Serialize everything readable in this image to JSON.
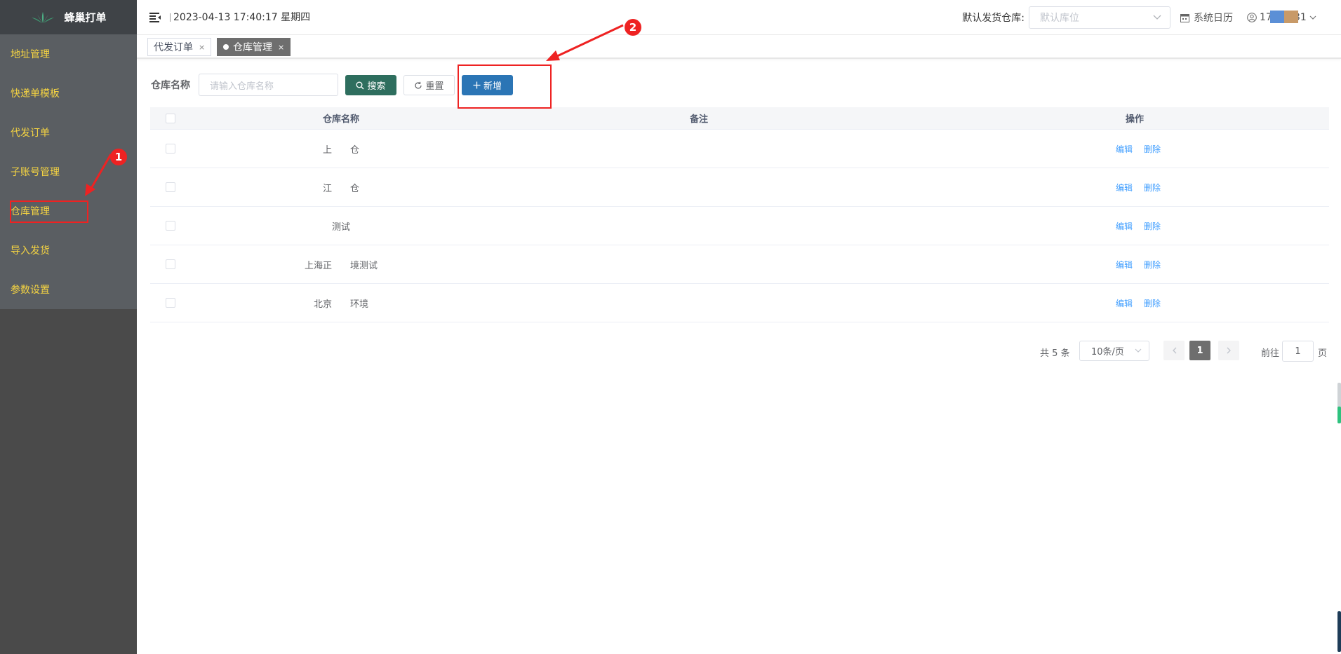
{
  "app": {
    "logo_text": "蜂巢打单"
  },
  "sidebar": {
    "items": [
      {
        "label": "地址管理"
      },
      {
        "label": "快递单模板"
      },
      {
        "label": "代发订单"
      },
      {
        "label": "子账号管理"
      },
      {
        "label": "仓库管理"
      },
      {
        "label": "导入发货"
      },
      {
        "label": "参数设置"
      }
    ]
  },
  "header": {
    "datetime": "2023-04-13 17:40:17 星期四",
    "warehouse_label": "默认发货仓库:",
    "warehouse_placeholder": "默认库位",
    "calendar_label": "系统日历",
    "user_text": "17         53931"
  },
  "tabs": [
    {
      "label": "代发订单",
      "active": false
    },
    {
      "label": "仓库管理",
      "active": true
    }
  ],
  "search": {
    "label": "仓库名称",
    "placeholder": "请输入仓库名称",
    "search_btn": "搜索",
    "reset_btn": "重置",
    "add_btn": "新增"
  },
  "table": {
    "columns": [
      "仓库名称",
      "备注",
      "操作"
    ],
    "rows": [
      {
        "name": "上　　仓",
        "note": ""
      },
      {
        "name": "江　　仓",
        "note": ""
      },
      {
        "name": "测试",
        "note": ""
      },
      {
        "name": "上海正　　境测试",
        "note": ""
      },
      {
        "name": "北京　　环境",
        "note": ""
      }
    ],
    "edit_label": "编辑",
    "delete_label": "删除"
  },
  "pagination": {
    "total": "共 5 条",
    "page_size": "10条/页",
    "current_page": "1",
    "goto_label": "前往",
    "goto_value": "1",
    "page_unit": "页"
  },
  "annotations": {
    "badge1": "1",
    "badge2": "2",
    "accent_color": "#ee2222"
  }
}
